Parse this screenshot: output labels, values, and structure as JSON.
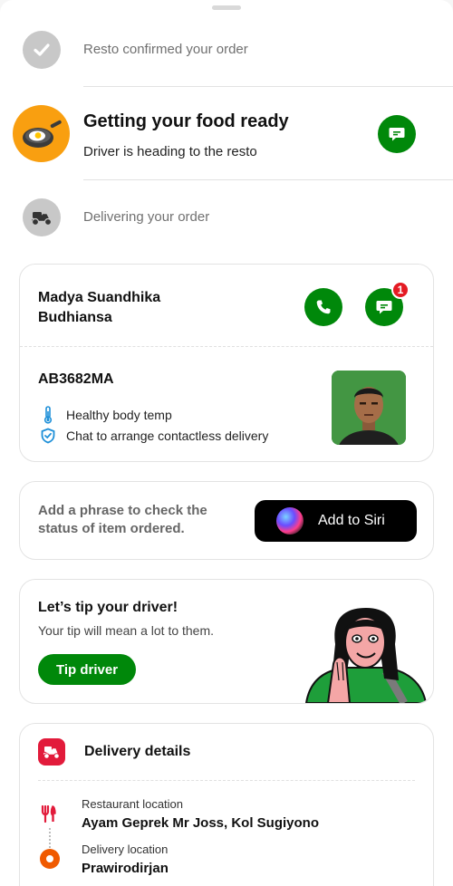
{
  "status": {
    "step1": "Resto confirmed your order",
    "step2_title": "Getting your food ready",
    "step2_sub": "Driver is heading to the resto",
    "step3": "Delivering your order"
  },
  "driver": {
    "name": "Madya Suandhika Budhiansa",
    "plate": "AB3682MA",
    "features": [
      "Healthy body temp",
      "Chat to arrange contactless delivery"
    ],
    "unread_count": "1"
  },
  "siri": {
    "prompt": "Add a phrase to check the status of item ordered.",
    "button": "Add to Siri"
  },
  "tip": {
    "title": "Let’s tip your driver!",
    "subtitle": "Your tip will mean a lot to them.",
    "button": "Tip driver"
  },
  "delivery": {
    "title": "Delivery details",
    "restaurant_label": "Restaurant location",
    "restaurant_value": "Ayam Geprek Mr Joss, Kol Sugiyono",
    "delivery_label": "Delivery location",
    "delivery_value": "Prawirodirjan"
  },
  "colors": {
    "brand_green": "#00880a",
    "accent_orange": "#ff8c00",
    "badge_red": "#e41b23",
    "delivery_icon_red": "#e21b3b",
    "location_orange": "#f05a00"
  }
}
